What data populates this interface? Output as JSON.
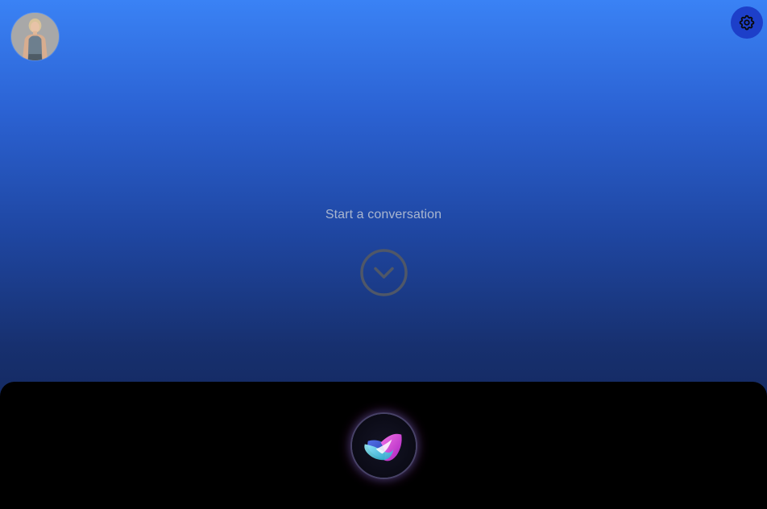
{
  "header": {
    "avatar_alt": "User avatar",
    "settings_icon": "gear-icon"
  },
  "conversation": {
    "empty_message": "Start a conversation",
    "scroll_icon": "chevron-down-circle-icon"
  },
  "assistant": {
    "orb_icon": "siri-orb-icon"
  },
  "colors": {
    "gradient_top": "#3a82f5",
    "gradient_bottom": "#0f1e48",
    "settings_bg": "#1d3fc9",
    "panel_bg": "#000000",
    "empty_text": "#a9b6cf",
    "orb_pink": "#e040e0",
    "orb_cyan": "#30d8e0"
  }
}
